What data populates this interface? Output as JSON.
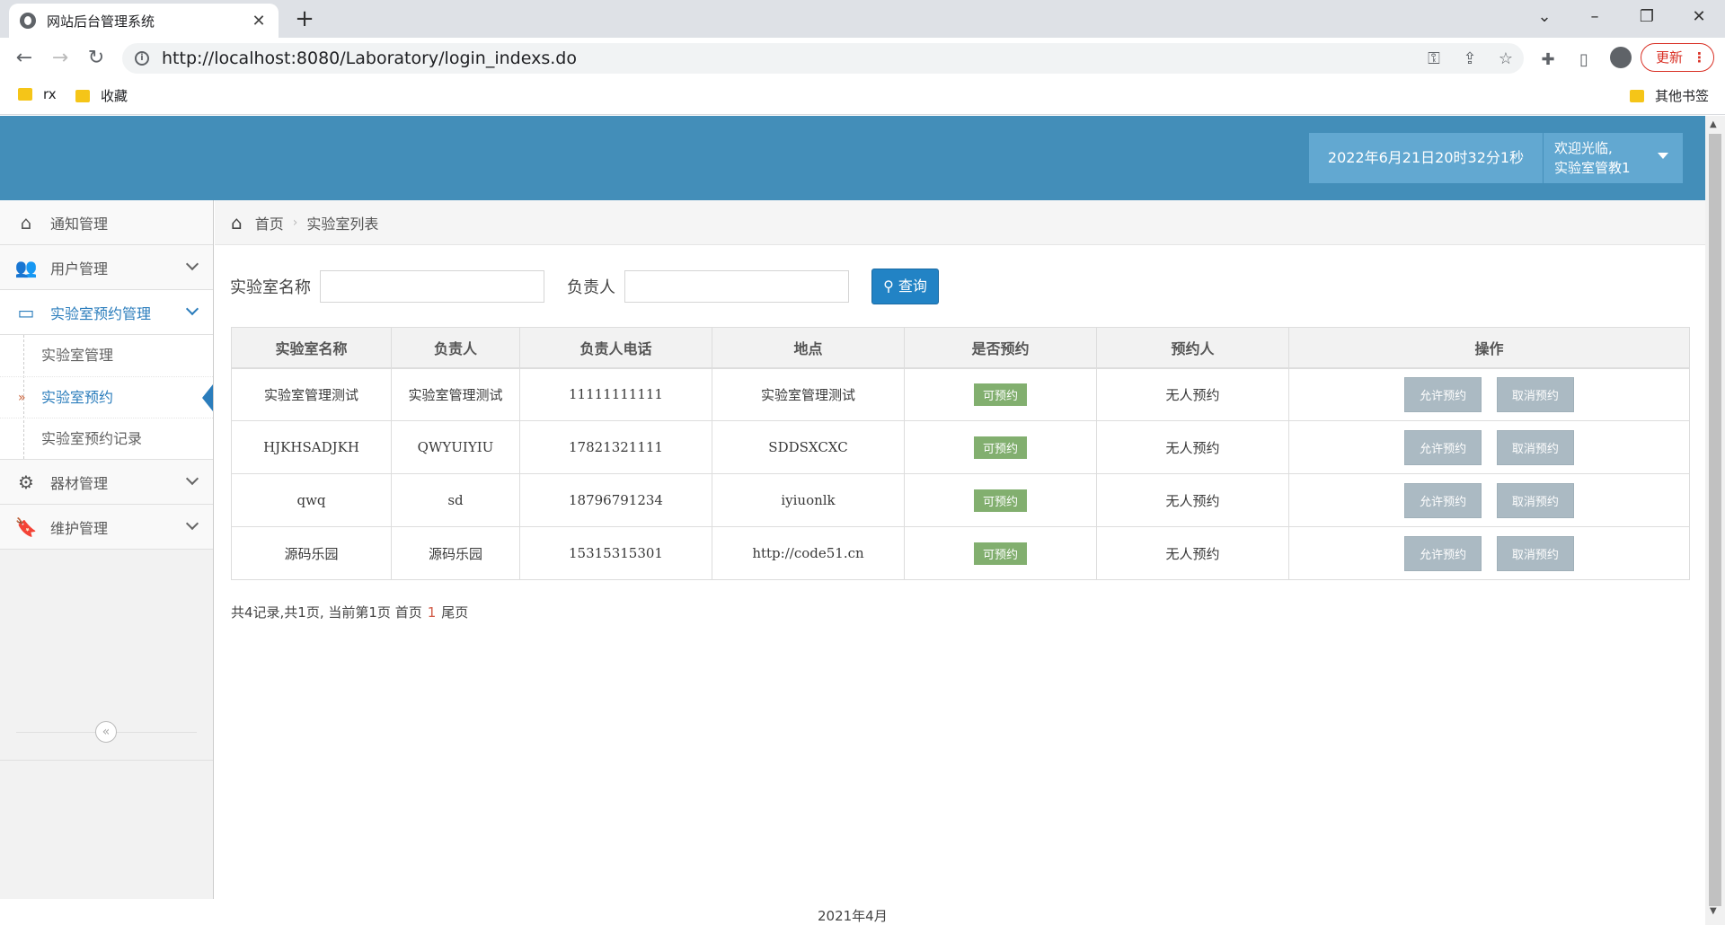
{
  "browser": {
    "tab_title": "网站后台管理系统",
    "url": "http://localhost:8080/Laboratory/login_indexs.do",
    "update_label": "更新",
    "bookmarks": [
      "rx",
      "收藏"
    ],
    "other_bookmarks": "其他书签"
  },
  "header": {
    "datetime": "2022年6月21日20时32分1秒",
    "welcome": "欢迎光临,",
    "username": "实验室管教1"
  },
  "sidebar": {
    "items": [
      {
        "label": "通知管理",
        "icon": "home-icon"
      },
      {
        "label": "用户管理",
        "icon": "users-icon"
      },
      {
        "label": "实验室预约管理",
        "icon": "desktop-icon"
      },
      {
        "label": "器材管理",
        "icon": "cogs-icon"
      },
      {
        "label": "维护管理",
        "icon": "bookmark-icon"
      }
    ],
    "subitems": [
      "实验室管理",
      "实验室预约",
      "实验室预约记录"
    ]
  },
  "breadcrumb": {
    "home": "首页",
    "current": "实验室列表"
  },
  "search": {
    "name_label": "实验室名称",
    "owner_label": "负责人",
    "query_button": "查询"
  },
  "table": {
    "headers": [
      "实验室名称",
      "负责人",
      "负责人电话",
      "地点",
      "是否预约",
      "预约人",
      "操作"
    ],
    "rows": [
      {
        "name": "实验室管理测试",
        "owner": "实验室管理测试",
        "phone": "11111111111",
        "location": "实验室管理测试",
        "status": "可预约",
        "booker": "无人预约"
      },
      {
        "name": "HJKHSADJKH",
        "owner": "QWYUIYIU",
        "phone": "17821321111",
        "location": "SDDSXCXC",
        "status": "可预约",
        "booker": "无人预约"
      },
      {
        "name": "qwq",
        "owner": "sd",
        "phone": "18796791234",
        "location": "iyiuonlk",
        "status": "可预约",
        "booker": "无人预约"
      },
      {
        "name": "源码乐园",
        "owner": "源码乐园",
        "phone": "15315315301",
        "location": "http://code51.cn",
        "status": "可预约",
        "booker": "无人预约"
      }
    ],
    "allow_label": "允许预约",
    "cancel_label": "取消预约"
  },
  "pager": {
    "summary": "共4记录,共1页, 当前第1页 首页",
    "current": "1",
    "last": "尾页"
  },
  "footer": "2021年4月",
  "colors": {
    "header": "#438eb9",
    "accent": "#2b7dbc",
    "badge": "#82af6f"
  }
}
